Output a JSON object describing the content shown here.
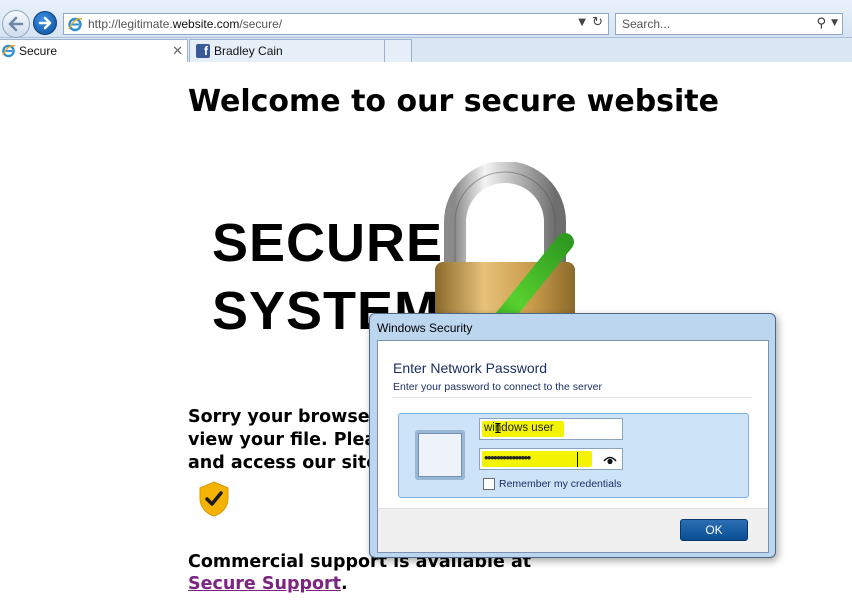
{
  "browser": {
    "address": {
      "prefix": "http://legitimate.",
      "domain": "website.com",
      "path": "/secure/"
    },
    "search": {
      "placeholder": "Search..."
    },
    "tabs": [
      {
        "label": "Secure",
        "active": true,
        "icon": "ie-icon"
      },
      {
        "label": "Bradley Cain",
        "active": false,
        "icon": "facebook-icon"
      }
    ]
  },
  "page": {
    "title": "Welcome to our secure website",
    "logo": {
      "line1": "SECURE",
      "line2": "SYSTEM"
    },
    "body_lines": [
      "Sorry your browser",
      "view your file. Pleas",
      "and access our site"
    ],
    "support_text": "Commercial support is available at",
    "support_link": "Secure Support",
    "support_period": "."
  },
  "dialog": {
    "title": "Windows Security",
    "heading": "Enter Network Password",
    "subheading": "Enter your password to connect to the server",
    "username_value": "windows user",
    "password_value": "•••••••••••••••",
    "remember_label": "Remember my credentials",
    "remember_checked": false,
    "ok_label": "OK"
  },
  "colors": {
    "accent": "#0a4f94",
    "highlight": "#f4f400",
    "link_visited": "#7b2480",
    "dialog_frame": "#bcd6ef"
  }
}
